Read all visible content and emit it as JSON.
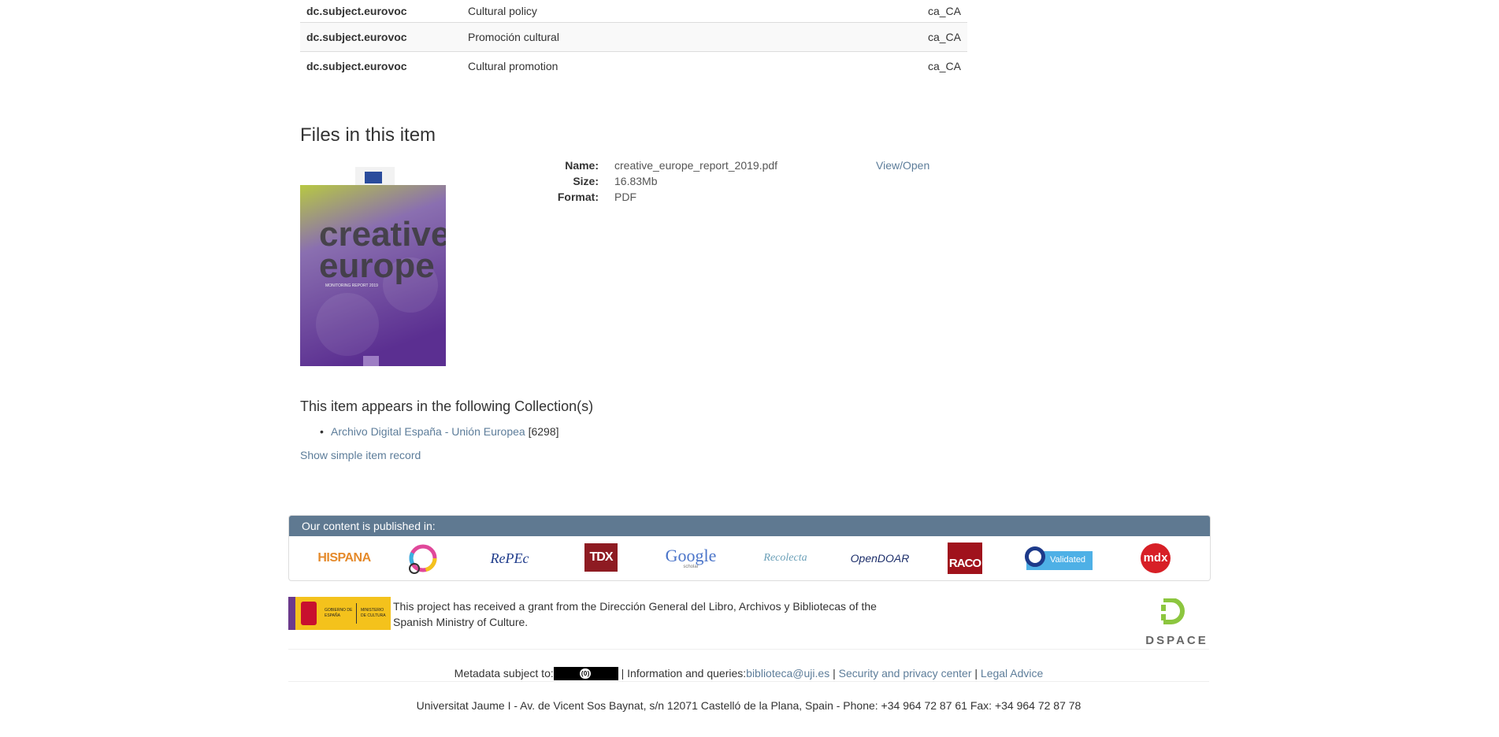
{
  "metadata_rows": [
    {
      "key": "dc.subject.eurovoc",
      "value": "Cultural policy",
      "lang": "ca_CA"
    },
    {
      "key": "dc.subject.eurovoc",
      "value": "Promoción cultural",
      "lang": "ca_CA"
    },
    {
      "key": "dc.subject.eurovoc",
      "value": "Cultural promotion",
      "lang": "ca_CA"
    }
  ],
  "files": {
    "title": "Files in this item",
    "thumbnail": {
      "text_line1": "creative",
      "text_line2": "europe",
      "subtitle": "MONITORING REPORT 2019"
    },
    "name_label": "Name:",
    "name": "creative_europe_report_2019.pdf",
    "size_label": "Size:",
    "size": "16.83Mb",
    "format_label": "Format:",
    "format": "PDF",
    "view_label": "View/Open"
  },
  "collections": {
    "title": "This item appears in the following Collection(s)",
    "items": [
      {
        "name": "Archivo Digital España - Unión Europea",
        "count": "[6298]"
      }
    ],
    "simple_record_link": "Show simple item record"
  },
  "published": {
    "heading": "Our content is published in:",
    "logos": {
      "hispana": "HISPANA",
      "repec": "RePEc",
      "tdx": "TDX",
      "google": "Google",
      "google_sub": "scholar",
      "recolecta": "Recolecta",
      "opendoar": "OpenDOAR",
      "raco": "RACO",
      "validated": "Validated",
      "mdx": "mdx"
    }
  },
  "grant": {
    "logo_left": "GOBIERNO DE ESPAÑA",
    "logo_right": "MINISTERIO DE CULTURA",
    "text": "This project has received a grant from the Dirección General del Libro, Archivos y Bibliotecas of the Spanish Ministry of Culture."
  },
  "dspace_label": "DSPACE",
  "footer": {
    "metadata_prefix": "Metadata subject to:",
    "pd_badge": "PUBLICDOMAIN",
    "info_prefix": " | Information and queries:",
    "email": "biblioteca@uji.es",
    "sep1": " | ",
    "security_link": "Security and privacy center",
    "sep2": " | ",
    "legal_link": "Legal Advice",
    "address": "Universitat Jaume I - Av. de Vicent Sos Baynat, s/n 12071 Castelló de la Plana, Spain - Phone: +34 964 72 87 61 Fax: +34 964 72 87 78"
  },
  "colors": {
    "accent": "#5f7991",
    "link": "#5d7d9a",
    "tdx": "#8e1b22",
    "raco": "#a0121c",
    "mdx": "#d71f26",
    "hispana": "#e58a2b"
  }
}
